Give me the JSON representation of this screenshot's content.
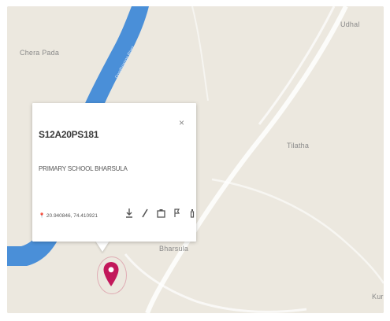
{
  "map": {
    "places": {
      "chera_pada": "Chera Pada",
      "udhal": "Udhal",
      "tilatha": "Tilatha",
      "bharsula": "Bharsula",
      "kuru": "Kuru"
    },
    "road_label": "Doodhganga River",
    "colors": {
      "land": "#ece8df",
      "water": "#4a8fd8",
      "road": "#ffffff",
      "marker": "#c2185b"
    }
  },
  "popup": {
    "title": "S12A20PS181",
    "subtitle": "PRIMARY SCHOOL BHARSULA",
    "coords": "20.940846, 74.410921",
    "close_icon": "close-icon",
    "tools": [
      "download-icon",
      "edit-icon",
      "camera-icon",
      "flag-icon",
      "info-icon"
    ]
  },
  "marker": {
    "icon": "map-pin-icon"
  }
}
